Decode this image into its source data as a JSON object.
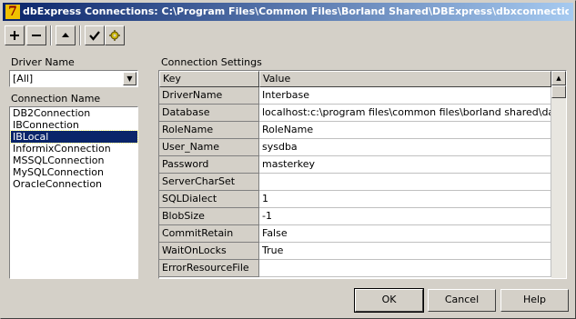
{
  "window": {
    "title": "dbExpress Connections: C:\\Program Files\\Common Files\\Borland Shared\\DBExpress\\dbxconnections.ini"
  },
  "toolbar": {
    "add_icon": "plus-icon",
    "remove_icon": "minus-icon",
    "up_icon": "triangle-up-icon",
    "check_icon": "checkmark-icon",
    "settings_icon": "gear-icon"
  },
  "driver": {
    "label": "Driver Name",
    "selected": "[All]"
  },
  "connections": {
    "label": "Connection Name",
    "items": [
      "DB2Connection",
      "IBConnection",
      "IBLocal",
      "InformixConnection",
      "MSSQLConnection",
      "MySQLConnection",
      "OracleConnection"
    ],
    "selected": "IBLocal"
  },
  "settings": {
    "label": "Connection Settings",
    "columns": [
      "Key",
      "Value"
    ],
    "rows": [
      {
        "key": "DriverName",
        "value": "Interbase"
      },
      {
        "key": "Database",
        "value": "localhost:c:\\program files\\common files\\borland shared\\data\\employee.gdb"
      },
      {
        "key": "RoleName",
        "value": "RoleName"
      },
      {
        "key": "User_Name",
        "value": "sysdba"
      },
      {
        "key": "Password",
        "value": "masterkey"
      },
      {
        "key": "ServerCharSet",
        "value": ""
      },
      {
        "key": "SQLDialect",
        "value": "1"
      },
      {
        "key": "BlobSize",
        "value": "-1"
      },
      {
        "key": "CommitRetain",
        "value": "False"
      },
      {
        "key": "WaitOnLocks",
        "value": "True"
      },
      {
        "key": "ErrorResourceFile",
        "value": ""
      }
    ]
  },
  "buttons": {
    "ok": "OK",
    "cancel": "Cancel",
    "help": "Help"
  },
  "colors": {
    "title_start": "#0a246a",
    "title_end": "#a6caf0",
    "face": "#d4d0c8",
    "selection": "#0a246a"
  }
}
